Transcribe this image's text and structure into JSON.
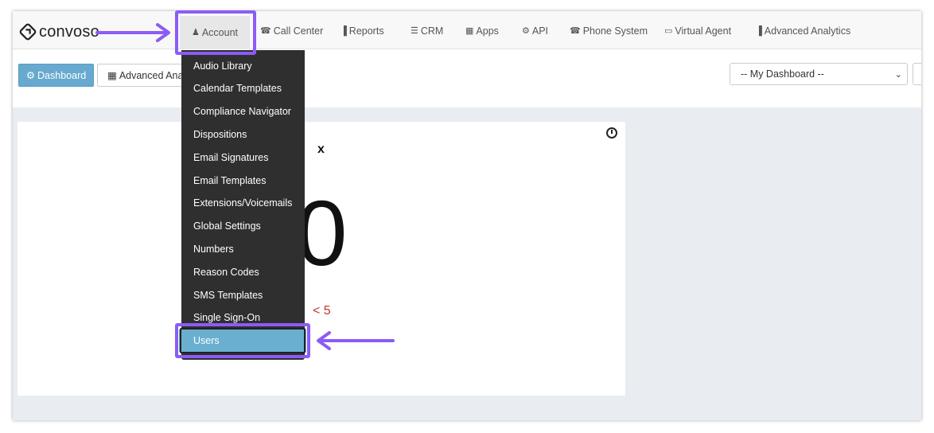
{
  "brand": {
    "name": "convoso"
  },
  "nav": [
    {
      "label": "Account",
      "icon": "user-icon",
      "glyph": "♟"
    },
    {
      "label": "Call Center",
      "icon": "phone-icon",
      "glyph": "☎"
    },
    {
      "label": "Reports",
      "icon": "bar-chart-icon",
      "glyph": "▐"
    },
    {
      "label": "CRM",
      "icon": "list-icon",
      "glyph": "☰"
    },
    {
      "label": "Apps",
      "icon": "grid-icon",
      "glyph": "▦"
    },
    {
      "label": "API",
      "icon": "gear-icon",
      "glyph": "⚙"
    },
    {
      "label": "Phone System",
      "icon": "phone-icon",
      "glyph": "☎"
    },
    {
      "label": "Virtual Agent",
      "icon": "monitor-icon",
      "glyph": "▭"
    },
    {
      "label": "Advanced Analytics",
      "icon": "bar-chart-icon",
      "glyph": "▐"
    }
  ],
  "subbar": {
    "dashboard_label": "Dashboard",
    "dashboard_glyph": "⚙",
    "advanced_label": "Advanced Analytics",
    "advanced_glyph": "▦",
    "select_value": "-- My Dashboard --",
    "select_glyph": "⌄"
  },
  "account_menu": [
    "Audio Library",
    "Calendar Templates",
    "Compliance Navigator",
    "Dispositions",
    "Email Signatures",
    "Email Templates",
    "Extensions/Voicemails",
    "Global Settings",
    "Numbers",
    "Reason Codes",
    "SMS Templates",
    "Single Sign-On",
    "Users"
  ],
  "account_menu_active": "Users",
  "widget": {
    "close_label": "x",
    "value": "0",
    "threshold": "< 5"
  },
  "colors": {
    "annotation": "#8b5cf6",
    "active": "#6aafd0",
    "threshold": "#c0392b"
  }
}
